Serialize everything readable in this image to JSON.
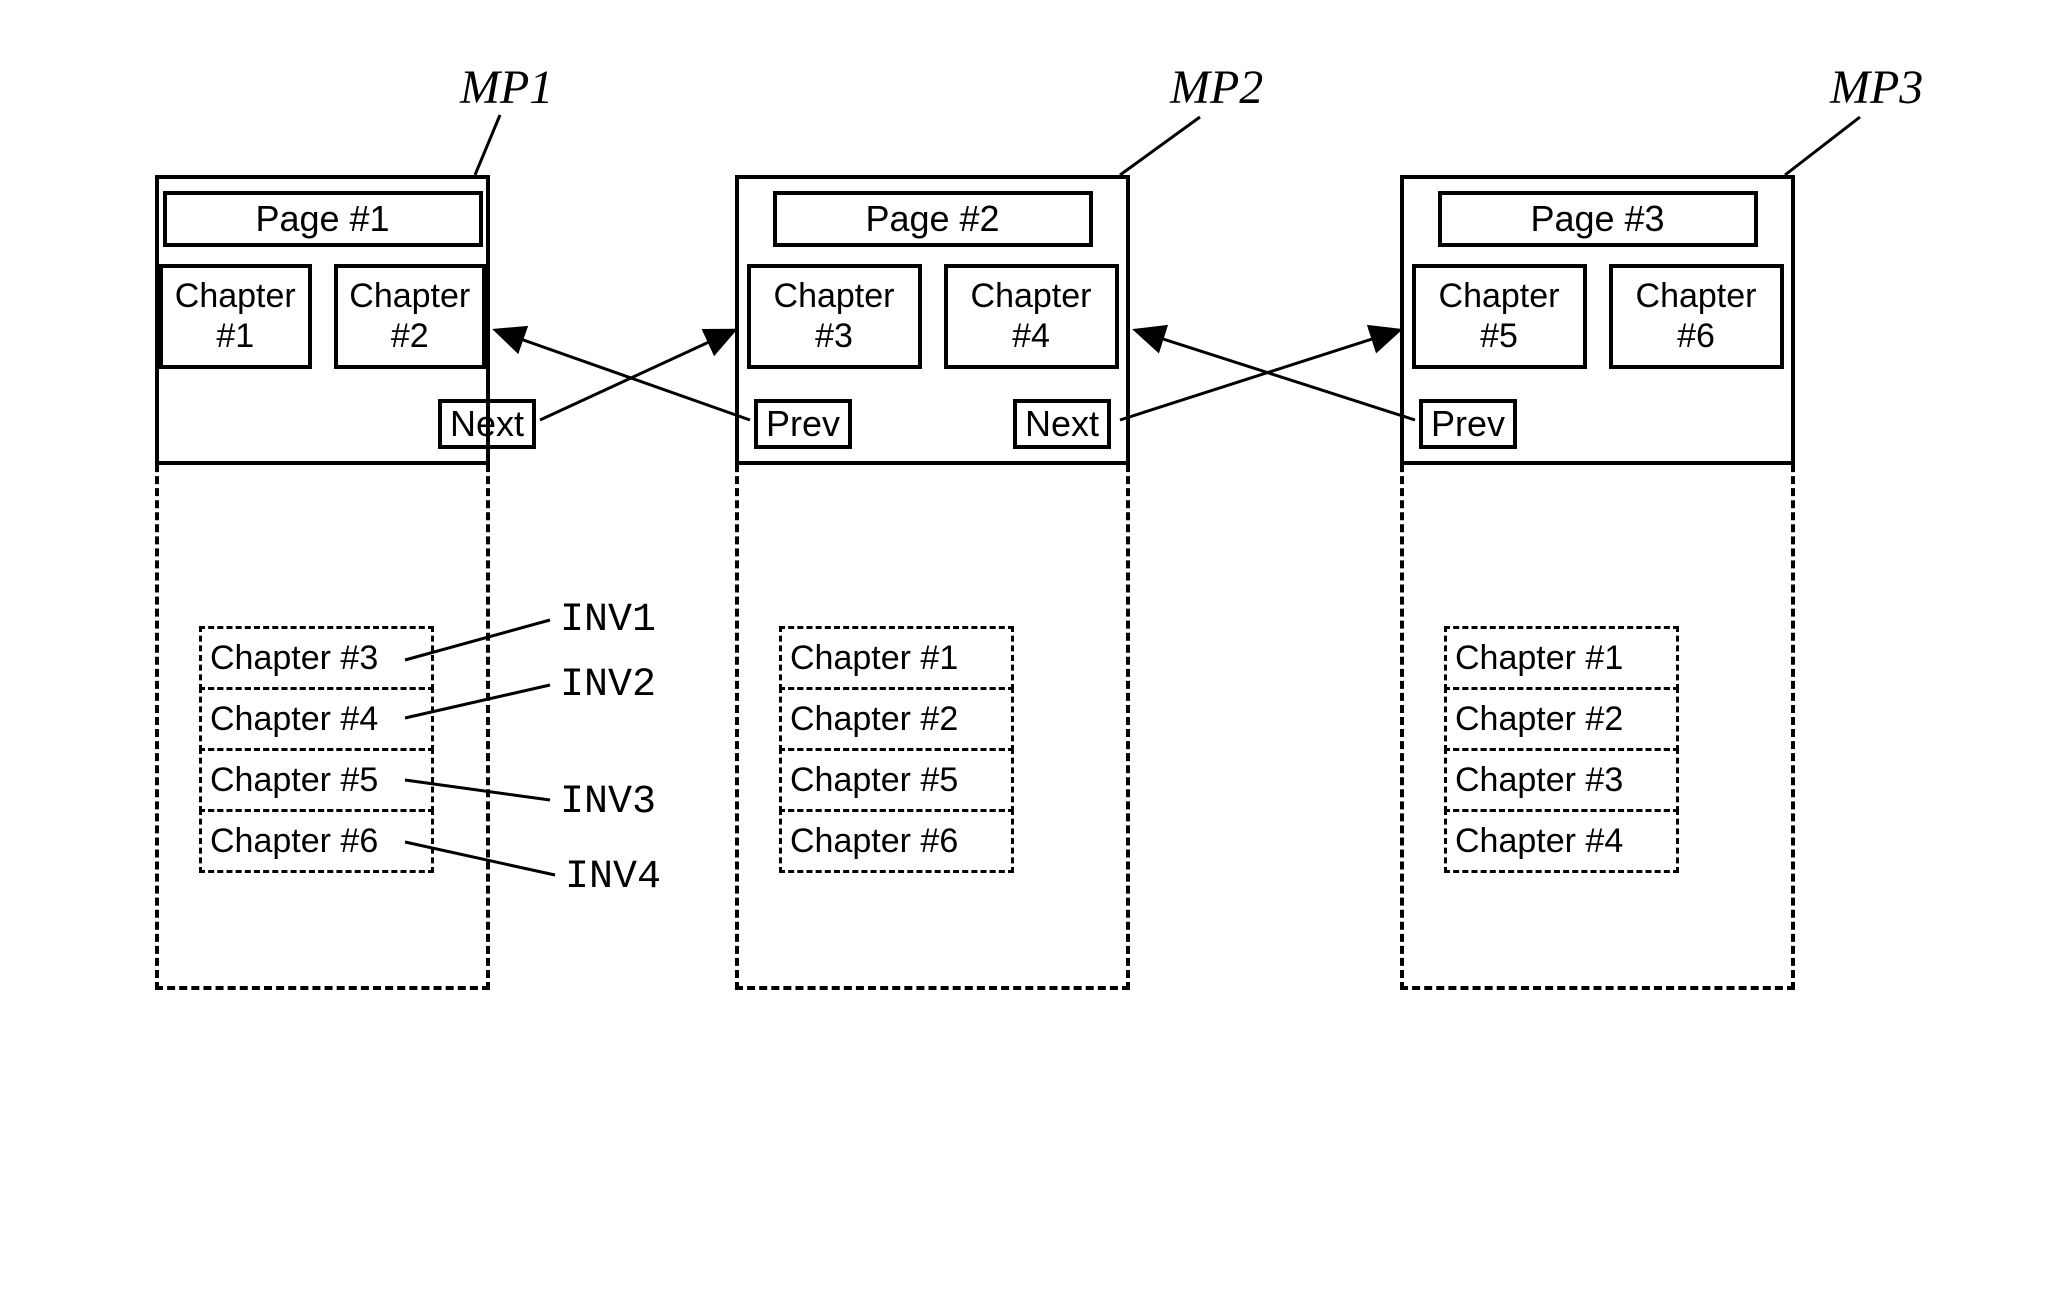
{
  "labels": {
    "mp1": "MP1",
    "mp2": "MP2",
    "mp3": "MP3",
    "inv1": "INV1",
    "inv2": "INV2",
    "inv3": "INV3",
    "inv4": "INV4"
  },
  "nav": {
    "next": "Next",
    "prev": "Prev"
  },
  "pages": [
    {
      "title": "Page #1",
      "chapters": [
        {
          "line1": "Chapter",
          "line2": "#1"
        },
        {
          "line1": "Chapter",
          "line2": "#2"
        }
      ],
      "has_prev": false,
      "has_next": true,
      "hidden_chapters": [
        "Chapter #3",
        "Chapter #4",
        "Chapter #5",
        "Chapter #6"
      ]
    },
    {
      "title": "Page #2",
      "chapters": [
        {
          "line1": "Chapter",
          "line2": "#3"
        },
        {
          "line1": "Chapter",
          "line2": "#4"
        }
      ],
      "has_prev": true,
      "has_next": true,
      "hidden_chapters": [
        "Chapter #1",
        "Chapter #2",
        "Chapter #5",
        "Chapter #6"
      ]
    },
    {
      "title": "Page #3",
      "chapters": [
        {
          "line1": "Chapter",
          "line2": "#5"
        },
        {
          "line1": "Chapter",
          "line2": "#6"
        }
      ],
      "has_prev": true,
      "has_next": false,
      "hidden_chapters": [
        "Chapter #1",
        "Chapter #2",
        "Chapter #3",
        "Chapter #4"
      ]
    }
  ]
}
